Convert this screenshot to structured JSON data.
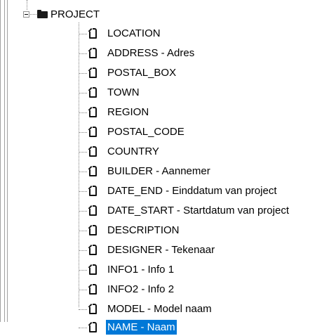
{
  "tree": {
    "root": {
      "label": "PROJECT",
      "expanded": true,
      "icon": "folder-icon"
    },
    "items": [
      {
        "label": "LOCATION",
        "icon": "document-icon"
      },
      {
        "label": "ADDRESS - Adres",
        "icon": "document-icon"
      },
      {
        "label": "POSTAL_BOX",
        "icon": "document-icon"
      },
      {
        "label": "TOWN",
        "icon": "document-icon"
      },
      {
        "label": "REGION",
        "icon": "document-icon"
      },
      {
        "label": "POSTAL_CODE",
        "icon": "document-icon"
      },
      {
        "label": "COUNTRY",
        "icon": "document-icon"
      },
      {
        "label": "BUILDER - Aannemer",
        "icon": "document-icon"
      },
      {
        "label": "DATE_END - Einddatum van project",
        "icon": "document-icon"
      },
      {
        "label": "DATE_START - Startdatum van project",
        "icon": "document-icon"
      },
      {
        "label": "DESCRIPTION",
        "icon": "document-icon"
      },
      {
        "label": "DESIGNER - Tekenaar",
        "icon": "document-icon"
      },
      {
        "label": "INFO1 - Info 1",
        "icon": "document-icon"
      },
      {
        "label": "INFO2 - Info 2",
        "icon": "document-icon"
      },
      {
        "label": "MODEL - Model naam",
        "icon": "document-icon"
      },
      {
        "label": "NAME - Naam",
        "icon": "document-icon",
        "selected": true
      }
    ],
    "selection_color": "#0078d7"
  }
}
